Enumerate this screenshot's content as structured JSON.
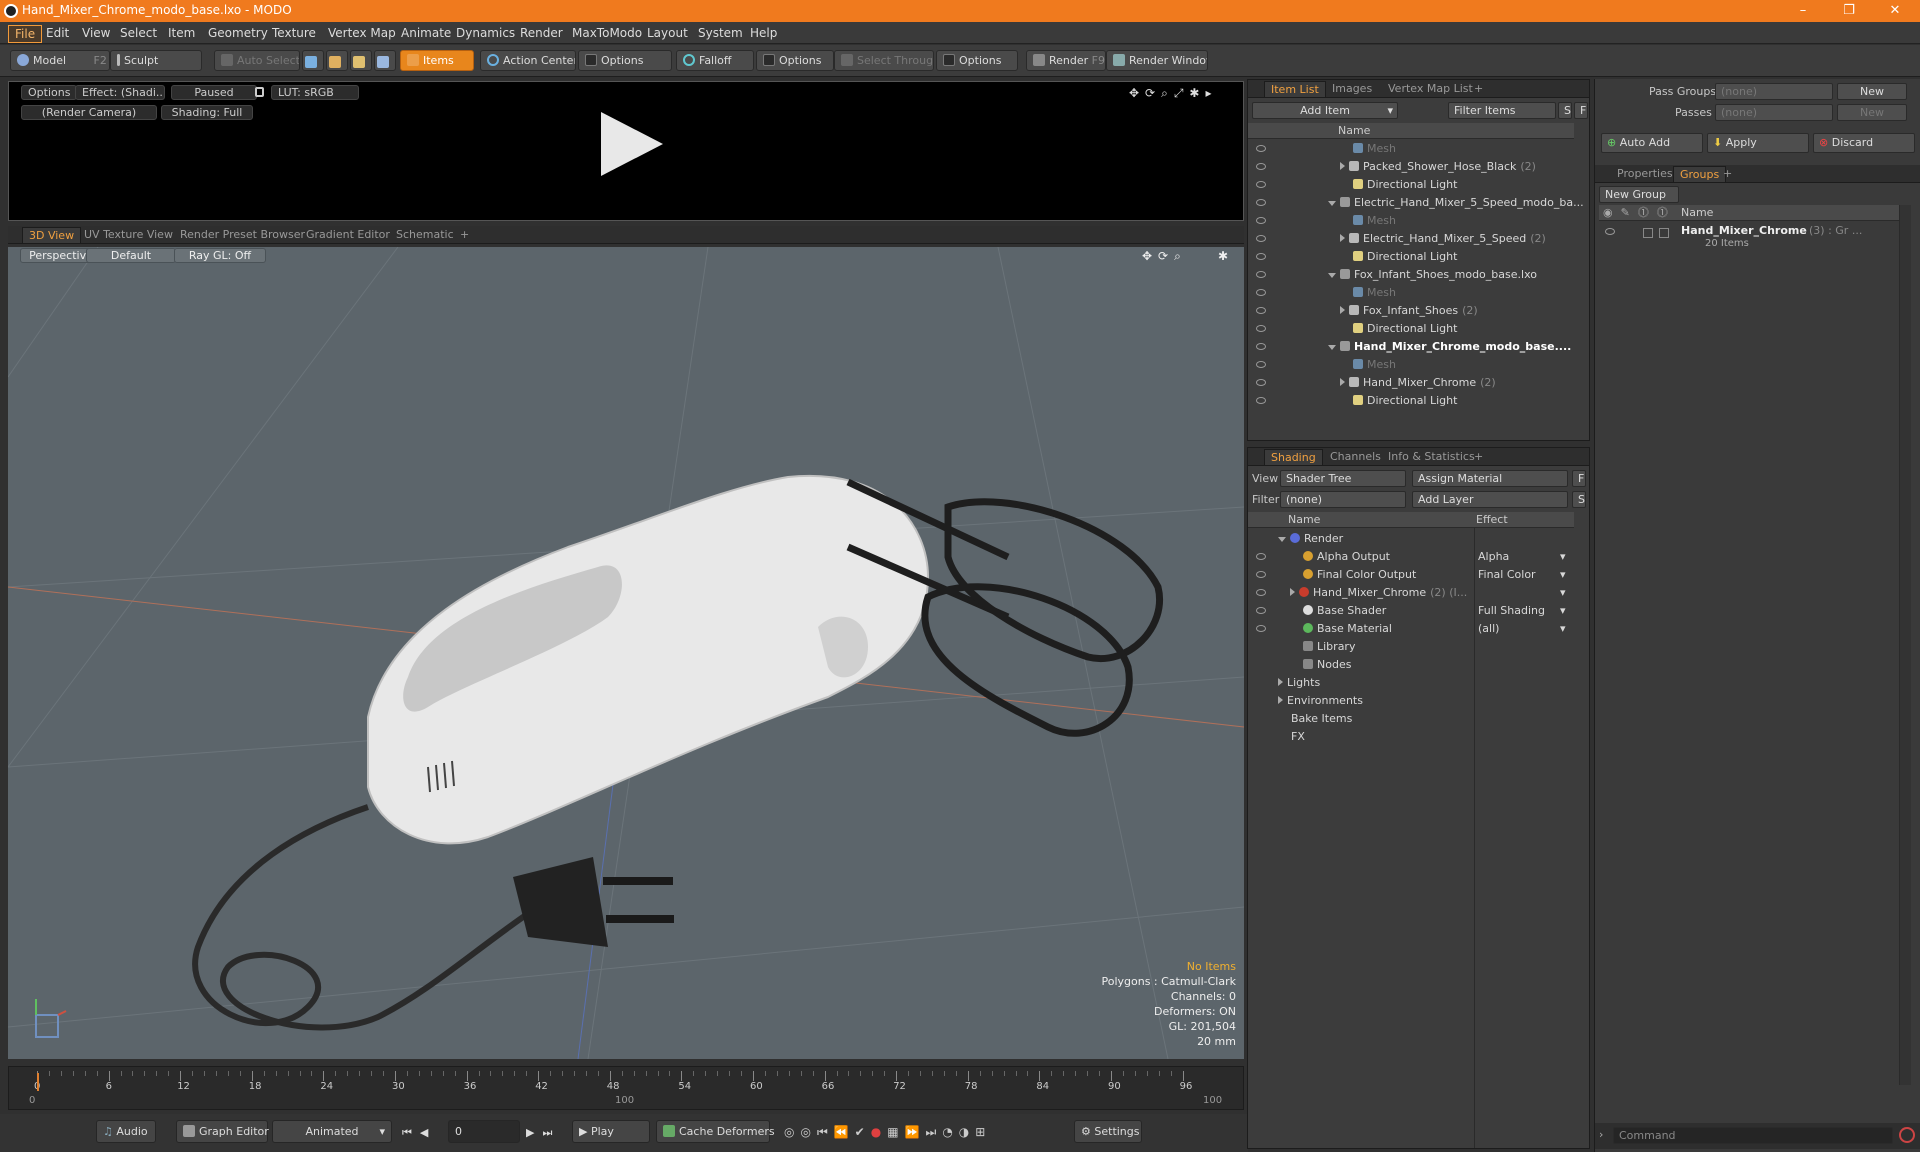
{
  "window": {
    "title": "Hand_Mixer_Chrome_modo_base.lxo - MODO",
    "min": "–",
    "max": "❐",
    "close": "✕"
  },
  "menu": [
    "File",
    "Edit",
    "View",
    "Select",
    "Item",
    "Geometry",
    "Texture",
    "Vertex Map",
    "Animate",
    "Dynamics",
    "Render",
    "MaxToModo",
    "Layout",
    "System",
    "Help"
  ],
  "toolbar": {
    "model": "Model",
    "model_key": "F2",
    "sculpt": "Sculpt",
    "auto_select": "Auto Select",
    "items": "Items",
    "action_center": "Action Center",
    "options1": "Options",
    "falloff": "Falloff",
    "options2": "Options",
    "select_through": "Select Through",
    "options3": "Options",
    "render": "Render",
    "render_key": "F9",
    "render_window": "Render Window"
  },
  "preview": {
    "options": "Options",
    "effect": "Effect: (Shadi...",
    "paused": "Paused",
    "lut": "LUT: sRGB",
    "camera": "(Render Camera)",
    "shading": "Shading: Full"
  },
  "view_tabs": [
    "3D View",
    "UV Texture View",
    "Render Preset Browser",
    "Gradient Editor",
    "Schematic",
    "+"
  ],
  "viewport": {
    "perspective": "Perspective",
    "default": "Default",
    "raygl": "Ray GL: Off",
    "stats": [
      "No Items",
      "Polygons : Catmull-Clark",
      "Channels: 0",
      "Deformers: ON",
      "GL: 201,504",
      "20 mm"
    ]
  },
  "timeline": {
    "ticks": [
      "0",
      "6",
      "12",
      "18",
      "24",
      "30",
      "36",
      "42",
      "48",
      "54",
      "60",
      "66",
      "72",
      "78",
      "84",
      "90",
      "96"
    ],
    "sub_start": "0",
    "sub_mid": "100",
    "sub_end": "100"
  },
  "transport": {
    "audio": "Audio",
    "graph_editor": "Graph Editor",
    "animated": "Animated",
    "frame": "0",
    "play": "Play",
    "cache": "Cache Deformers",
    "settings": "Settings"
  },
  "item_list": {
    "tabs": [
      "Item List",
      "Images",
      "Vertex Map List",
      "+"
    ],
    "add_item": "Add Item",
    "filter": "Filter Items",
    "s": "S",
    "f": "F",
    "col_name": "Name",
    "rows": [
      {
        "label": "Mesh",
        "count": "",
        "indent": 2,
        "kind": "mesh"
      },
      {
        "label": "Packed_Shower_Hose_Black",
        "count": "(2)",
        "indent": 2,
        "kind": "group"
      },
      {
        "label": "Directional Light",
        "count": "",
        "indent": 2,
        "kind": "light"
      },
      {
        "label": "Electric_Hand_Mixer_5_Speed_modo_ba...",
        "count": "",
        "indent": 1,
        "kind": "scene"
      },
      {
        "label": "Mesh",
        "count": "",
        "indent": 2,
        "kind": "mesh"
      },
      {
        "label": "Electric_Hand_Mixer_5_Speed",
        "count": "(2)",
        "indent": 2,
        "kind": "group"
      },
      {
        "label": "Directional Light",
        "count": "",
        "indent": 2,
        "kind": "light"
      },
      {
        "label": "Fox_Infant_Shoes_modo_base.lxo",
        "count": "",
        "indent": 1,
        "kind": "scene"
      },
      {
        "label": "Mesh",
        "count": "",
        "indent": 2,
        "kind": "mesh"
      },
      {
        "label": "Fox_Infant_Shoes",
        "count": "(2)",
        "indent": 2,
        "kind": "group"
      },
      {
        "label": "Directional Light",
        "count": "",
        "indent": 2,
        "kind": "light"
      },
      {
        "label": "Hand_Mixer_Chrome_modo_base....",
        "count": "",
        "indent": 1,
        "kind": "scene",
        "bold": true
      },
      {
        "label": "Mesh",
        "count": "",
        "indent": 2,
        "kind": "mesh"
      },
      {
        "label": "Hand_Mixer_Chrome",
        "count": "(2)",
        "indent": 2,
        "kind": "group"
      },
      {
        "label": "Directional Light",
        "count": "",
        "indent": 2,
        "kind": "light"
      }
    ]
  },
  "shading": {
    "tabs": [
      "Shading",
      "Channels",
      "Info & Statistics",
      "+"
    ],
    "view_label": "View",
    "view_value": "Shader Tree",
    "assign": "Assign Material",
    "f": "F",
    "filter_label": "Filter",
    "filter_value": "(none)",
    "add_layer": "Add Layer",
    "s": "S",
    "col_name": "Name",
    "col_effect": "Effect",
    "rows": [
      {
        "label": "Render",
        "effect": "",
        "indent": 0,
        "color": "#5a6cd8"
      },
      {
        "label": "Alpha Output",
        "effect": "Alpha",
        "indent": 1,
        "color": "#d8a030"
      },
      {
        "label": "Final Color Output",
        "effect": "Final Color",
        "indent": 1,
        "color": "#d8a030"
      },
      {
        "label": "Hand_Mixer_Chrome",
        "count": "(2) (I...",
        "effect": "",
        "indent": 1,
        "color": "#c83c2c"
      },
      {
        "label": "Base Shader",
        "effect": "Full Shading",
        "indent": 1,
        "color": "#dddddd"
      },
      {
        "label": "Base Material",
        "effect": "(all)",
        "indent": 1,
        "color": "#5cb85c"
      },
      {
        "label": "Library",
        "effect": "",
        "indent": 1,
        "color": ""
      },
      {
        "label": "Nodes",
        "effect": "",
        "indent": 1,
        "color": ""
      },
      {
        "label": "Lights",
        "effect": "",
        "indent": 0,
        "color": ""
      },
      {
        "label": "Environments",
        "effect": "",
        "indent": 0,
        "color": ""
      },
      {
        "label": "Bake Items",
        "effect": "",
        "indent": 0,
        "color": ""
      },
      {
        "label": "FX",
        "effect": "",
        "indent": 0,
        "color": ""
      }
    ]
  },
  "right": {
    "pass_groups": "Pass Groups",
    "pass_groups_val": "(none)",
    "new": "New",
    "passes": "Passes",
    "passes_val": "(none)",
    "new2": "New",
    "auto_add": "Auto Add",
    "apply": "Apply",
    "discard": "Discard",
    "tabs": [
      "Properties",
      "Groups",
      "+"
    ],
    "new_group": "New Group",
    "col_name": "Name",
    "group_name": "Hand_Mixer_Chrome",
    "group_meta": "(3) : Gr ...",
    "group_items": "20 Items",
    "command": "Command"
  }
}
